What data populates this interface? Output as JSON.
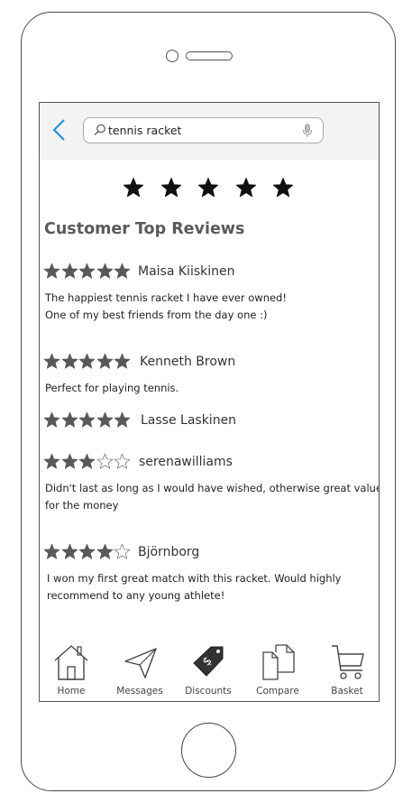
{
  "search": {
    "value": "tennis racket",
    "placeholder": ""
  },
  "rating_filter": {
    "value": 5,
    "max": 5
  },
  "section_title": "Customer Top Reviews",
  "reviews": [
    {
      "name": "Maisa Kiiskinen",
      "rating": 5,
      "lines": [
        "The happiest tennis racket I have ever owned!",
        "One of my best friends from the day one :)"
      ]
    },
    {
      "name": "Kenneth Brown",
      "rating": 5,
      "lines": [
        "Perfect for playing tennis."
      ]
    },
    {
      "name": "Lasse Laskinen",
      "rating": 5,
      "lines": []
    },
    {
      "name": "serenawilliams",
      "rating": 3,
      "lines": [
        "Didn't last as long as I would have wished, otherwise great value",
        "for the money"
      ]
    },
    {
      "name": "Björnborg",
      "rating": 4,
      "lines": [
        "I won my first great match with this racket. Would highly",
        "recommend to any young athlete!"
      ]
    }
  ],
  "nav": {
    "home": "Home",
    "messages": "Messages",
    "discounts": "Discounts",
    "compare": "Compare",
    "basket": "Basket"
  },
  "colors": {
    "accent": "#1a8ee0",
    "star_filled": "#595959",
    "filter_star": "#111111"
  }
}
